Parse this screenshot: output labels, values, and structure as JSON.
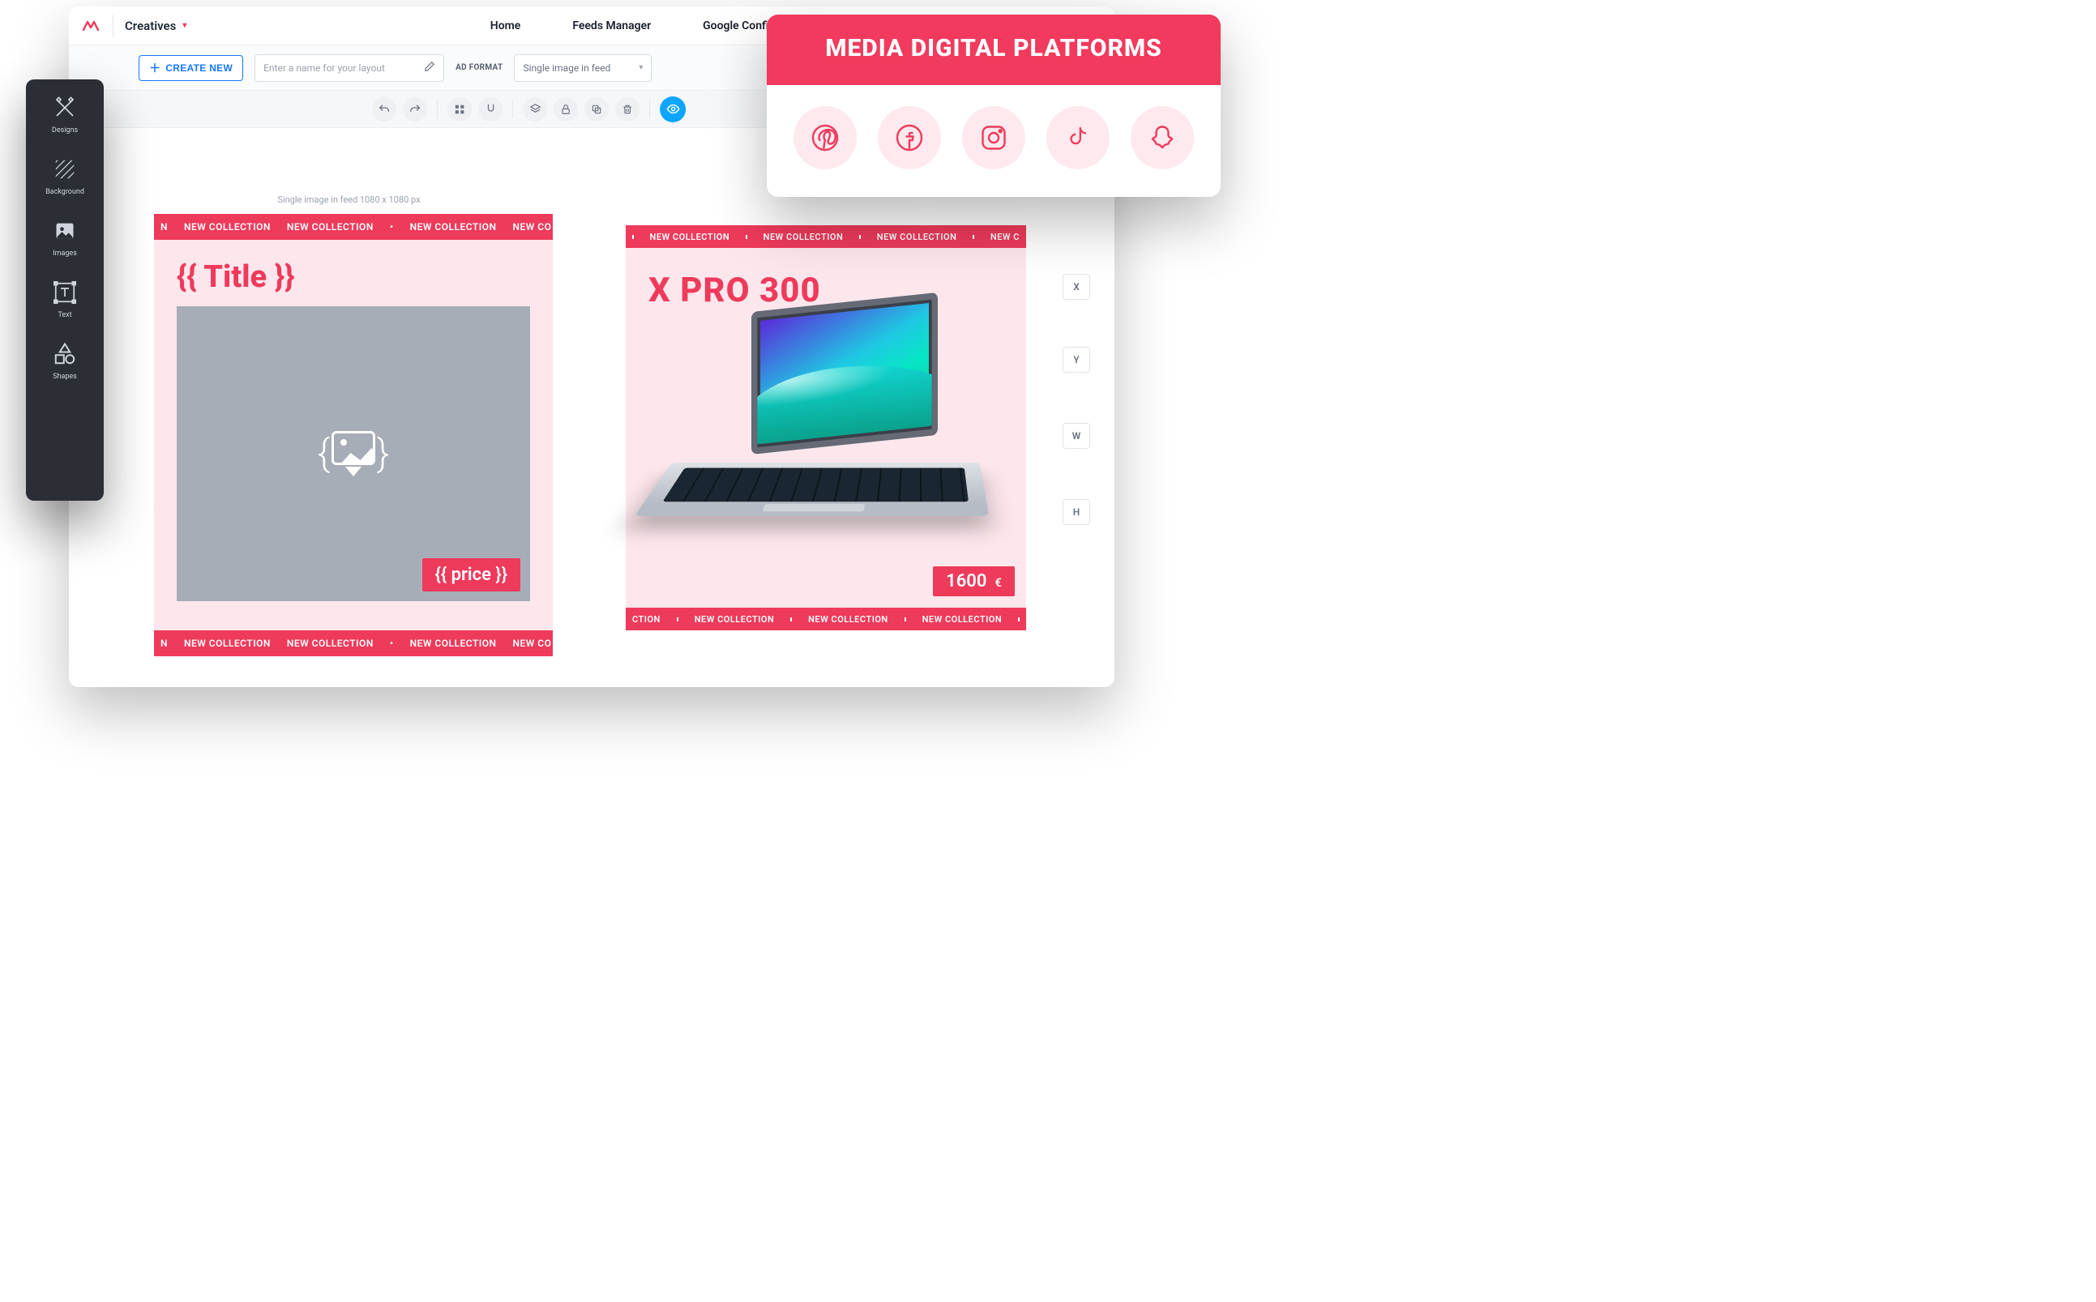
{
  "topbar": {
    "brand_dropdown": "Creatives",
    "nav": [
      "Home",
      "Feeds Manager",
      "Google Configuration"
    ]
  },
  "subbar": {
    "create_label": "CREATE NEW",
    "layout_placeholder": "Enter a name for your layout",
    "adformat_label": "AD FORMAT",
    "adformat_value": "Single image in feed"
  },
  "canvas": {
    "size_label": "Single image in feed 1080 x 1080 px"
  },
  "template": {
    "ticker_text": "NEW COLLECTION",
    "ticker_prefix": "N",
    "ticker_suffix": "NEW CO",
    "title_placeholder": "{{ Title }}",
    "price_placeholder": "{{ price }}"
  },
  "product": {
    "ticker_text": "NEW COLLECTION",
    "ticker_abbrev": "CTION",
    "ticker_abbrev2": "NEW C",
    "title": "X PRO 300",
    "price": "1600",
    "currency": "€"
  },
  "properties": {
    "x": "X",
    "y": "Y",
    "w": "W",
    "h": "H"
  },
  "sidebar": {
    "items": [
      {
        "label": "Designs"
      },
      {
        "label": "Background"
      },
      {
        "label": "Images"
      },
      {
        "label": "Text"
      },
      {
        "label": "Shapes"
      }
    ]
  },
  "media_overlay": {
    "title": "MEDIA DIGITAL PLATFORMS",
    "platforms": [
      "pinterest",
      "facebook",
      "instagram",
      "tiktok",
      "snapchat"
    ]
  }
}
